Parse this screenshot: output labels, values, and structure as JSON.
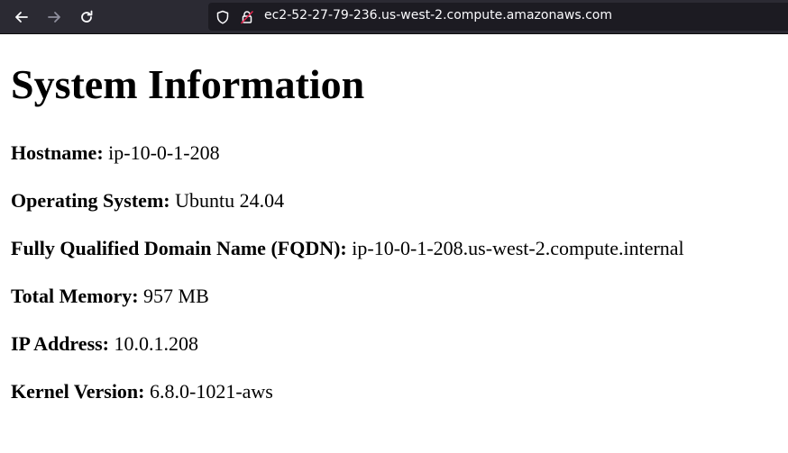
{
  "browser": {
    "url": "ec2-52-27-79-236.us-west-2.compute.amazonaws.com",
    "icons": [
      "back-arrow-icon",
      "forward-arrow-icon",
      "reload-icon",
      "tracking-shield-icon",
      "insecure-lock-icon"
    ],
    "colors": {
      "toolbar": "#2b2a33",
      "urlbar": "#1c1b22",
      "text": "#fbfbfe"
    }
  },
  "page": {
    "title": "System Information",
    "rows": [
      {
        "label": "Hostname:",
        "value": "ip-10-0-1-208"
      },
      {
        "label": "Operating System:",
        "value": "Ubuntu 24.04"
      },
      {
        "label": "Fully Qualified Domain Name (FQDN):",
        "value": "ip-10-0-1-208.us-west-2.compute.internal"
      },
      {
        "label": "Total Memory:",
        "value": "957 MB"
      },
      {
        "label": "IP Address:",
        "value": "10.0.1.208"
      },
      {
        "label": "Kernel Version:",
        "value": "6.8.0-1021-aws"
      }
    ]
  }
}
